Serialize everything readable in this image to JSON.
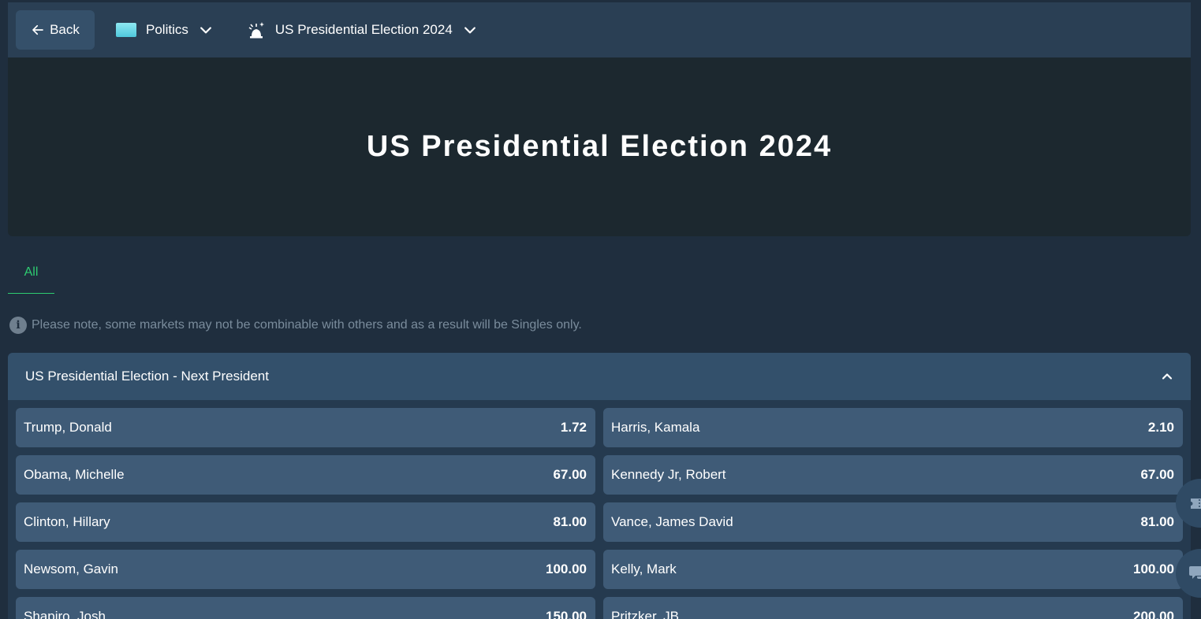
{
  "topbar": {
    "back_label": "Back",
    "category": "Politics",
    "event": "US Presidential Election 2024"
  },
  "hero": {
    "title": "US Presidential Election 2024"
  },
  "tabs": [
    {
      "label": "All",
      "active": true
    }
  ],
  "note": "Please note, some markets may not be combinable with others and as a result will be Singles only.",
  "market": {
    "title": "US Presidential Election - Next President",
    "selections": [
      {
        "name": "Trump, Donald",
        "odds": "1.72"
      },
      {
        "name": "Harris, Kamala",
        "odds": "2.10"
      },
      {
        "name": "Obama, Michelle",
        "odds": "67.00"
      },
      {
        "name": "Kennedy Jr, Robert",
        "odds": "67.00"
      },
      {
        "name": "Clinton, Hillary",
        "odds": "81.00"
      },
      {
        "name": "Vance, James David",
        "odds": "81.00"
      },
      {
        "name": "Newsom, Gavin",
        "odds": "100.00"
      },
      {
        "name": "Kelly, Mark",
        "odds": "100.00"
      },
      {
        "name": "Shapiro, Josh",
        "odds": "150.00"
      },
      {
        "name": "Pritzker, JB",
        "odds": "200.00"
      }
    ]
  },
  "colors": {
    "background": "#1f2e3e",
    "topbar": "#2a3f54",
    "hero": "#1c282f",
    "selection": "#3f5b77",
    "accent_green": "#2ecc71"
  },
  "icons": {
    "back": "arrow-left-icon",
    "flag": "flag-icon",
    "event": "alarm-icon",
    "chevron": "chevron-down-icon",
    "collapse": "chevron-up-icon",
    "info": "info-icon",
    "betslip": "ticket-icon",
    "chat": "chat-icon"
  }
}
